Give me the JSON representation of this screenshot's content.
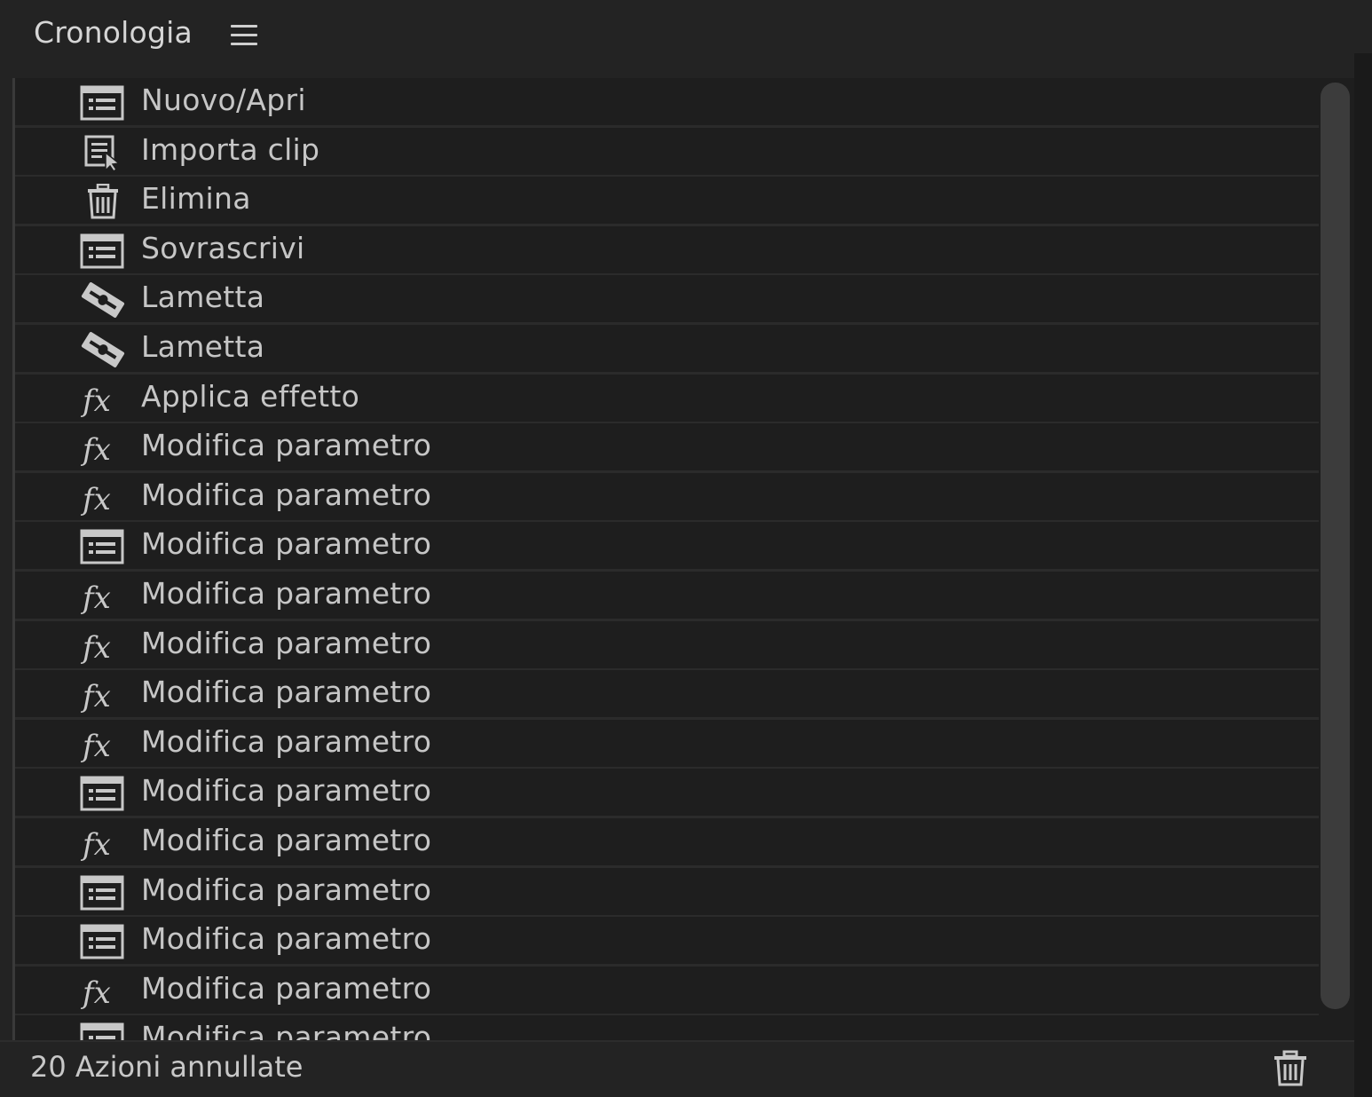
{
  "panel": {
    "title": "Cronologia",
    "menu_icon": "hamburger-menu-icon"
  },
  "history": {
    "items": [
      {
        "label": "Nuovo/Apri",
        "icon": "sequence-icon"
      },
      {
        "label": "Importa clip",
        "icon": "import-clip-icon"
      },
      {
        "label": "Elimina",
        "icon": "trash-icon"
      },
      {
        "label": "Sovrascrivi",
        "icon": "sequence-icon"
      },
      {
        "label": "Lametta",
        "icon": "razor-blade-icon"
      },
      {
        "label": "Lametta",
        "icon": "razor-blade-icon"
      },
      {
        "label": "Applica effetto",
        "icon": "fx-icon"
      },
      {
        "label": "Modifica parametro",
        "icon": "fx-icon"
      },
      {
        "label": "Modifica parametro",
        "icon": "fx-icon"
      },
      {
        "label": "Modifica parametro",
        "icon": "sequence-icon"
      },
      {
        "label": "Modifica parametro",
        "icon": "fx-icon"
      },
      {
        "label": "Modifica parametro",
        "icon": "fx-icon"
      },
      {
        "label": "Modifica parametro",
        "icon": "fx-icon"
      },
      {
        "label": "Modifica parametro",
        "icon": "fx-icon"
      },
      {
        "label": "Modifica parametro",
        "icon": "sequence-icon"
      },
      {
        "label": "Modifica parametro",
        "icon": "fx-icon"
      },
      {
        "label": "Modifica parametro",
        "icon": "sequence-icon"
      },
      {
        "label": "Modifica parametro",
        "icon": "sequence-icon"
      },
      {
        "label": "Modifica parametro",
        "icon": "fx-icon"
      },
      {
        "label": "Modifica parametro",
        "icon": "sequence-icon"
      }
    ]
  },
  "footer": {
    "status": "20 Azioni annullate",
    "delete_icon": "trash-icon"
  },
  "colors": {
    "panel_bg": "#232323",
    "list_bg": "#1e1e1e",
    "row_divider": "#2b2b2b",
    "text": "#c6c6c6"
  }
}
